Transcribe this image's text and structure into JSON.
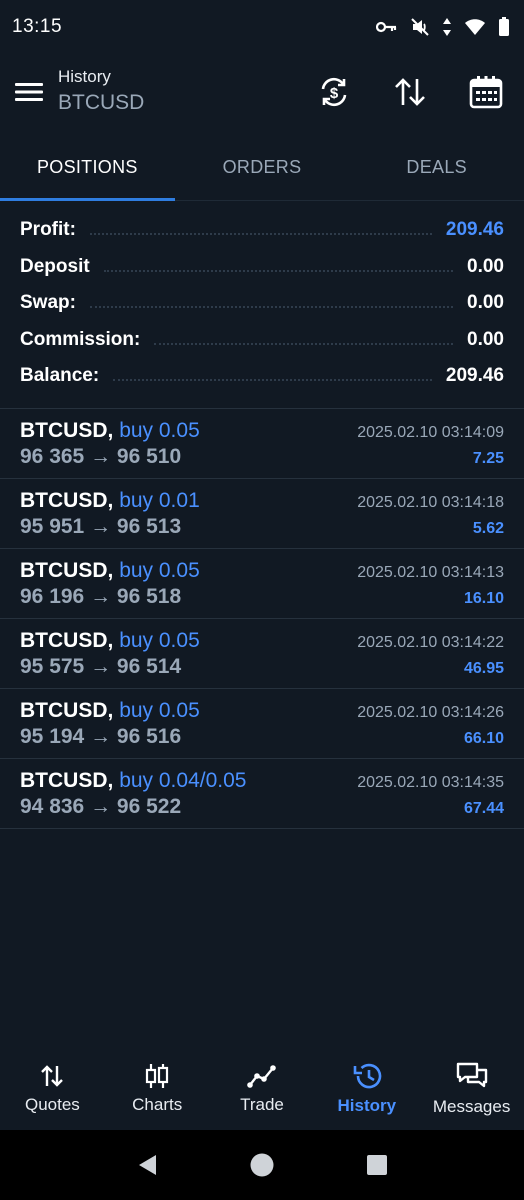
{
  "status_bar": {
    "time": "13:15"
  },
  "app_bar": {
    "subtitle": "History",
    "title": "BTCUSD"
  },
  "tabs": [
    {
      "label": "POSITIONS",
      "active": true
    },
    {
      "label": "ORDERS",
      "active": false
    },
    {
      "label": "DEALS",
      "active": false
    }
  ],
  "summary": [
    {
      "label": "Profit:",
      "value": "209.46"
    },
    {
      "label": "Deposit",
      "value": "0.00"
    },
    {
      "label": "Swap:",
      "value": "0.00"
    },
    {
      "label": "Commission:",
      "value": "0.00"
    },
    {
      "label": "Balance:",
      "value": "209.46"
    }
  ],
  "deals": [
    {
      "symbol": "BTCUSD,",
      "side": "buy 0.05",
      "time": "2025.02.10 03:14:09",
      "prices": "96 365 → 96 510",
      "profit": "7.25"
    },
    {
      "symbol": "BTCUSD,",
      "side": "buy 0.01",
      "time": "2025.02.10 03:14:18",
      "prices": "95 951 → 96 513",
      "profit": "5.62"
    },
    {
      "symbol": "BTCUSD,",
      "side": "buy 0.05",
      "time": "2025.02.10 03:14:13",
      "prices": "96 196 → 96 518",
      "profit": "16.10"
    },
    {
      "symbol": "BTCUSD,",
      "side": "buy 0.05",
      "time": "2025.02.10 03:14:22",
      "prices": "95 575 → 96 514",
      "profit": "46.95"
    },
    {
      "symbol": "BTCUSD,",
      "side": "buy 0.05",
      "time": "2025.02.10 03:14:26",
      "prices": "95 194 → 96 516",
      "profit": "66.10"
    },
    {
      "symbol": "BTCUSD,",
      "side": "buy 0.04/0.05",
      "time": "2025.02.10 03:14:35",
      "prices": "94 836 → 96 522",
      "profit": "67.44"
    }
  ],
  "bottom_nav": [
    {
      "label": "Quotes",
      "icon": "quotes-icon",
      "active": false
    },
    {
      "label": "Charts",
      "icon": "charts-icon",
      "active": false
    },
    {
      "label": "Trade",
      "icon": "trade-icon",
      "active": false
    },
    {
      "label": "History",
      "icon": "history-icon",
      "active": true
    },
    {
      "label": "Messages",
      "icon": "messages-icon",
      "active": false
    }
  ],
  "colors": {
    "background": "#111923",
    "accent": "#4a90ff",
    "muted": "#9aa8b8",
    "tab_indicator": "#2f7de0"
  }
}
